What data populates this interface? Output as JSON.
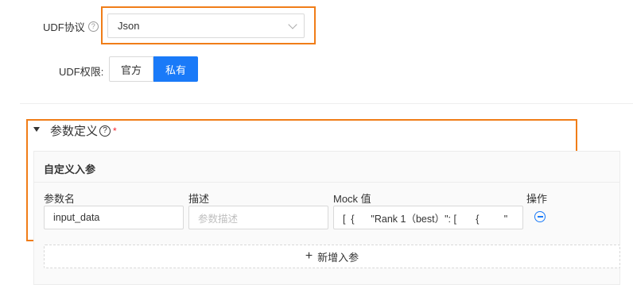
{
  "udf_protocol": {
    "label": "UDF协议",
    "help": "?",
    "value": "Json"
  },
  "udf_permission": {
    "label": "UDF权限:",
    "options": [
      "官方",
      "私有"
    ],
    "selected": "私有"
  },
  "params": {
    "title": "参数定义",
    "help": "?",
    "required": "*",
    "sub_title": "自定义入参",
    "columns": [
      "参数名",
      "描述",
      "Mock 值",
      "操作"
    ],
    "rows": [
      {
        "name": "input_data",
        "desc_placeholder": "参数描述",
        "mock": "[  {      \"Rank 1（best）\": [       {         \""
      }
    ],
    "add_label": "新增入参"
  },
  "colors": {
    "accent": "#1a7af8",
    "highlight": "#f07d18",
    "required": "#f5222d"
  },
  "icons": [
    "help-icon",
    "chevron-down-icon",
    "caret-down-icon",
    "minus-circle-icon",
    "plus-icon"
  ]
}
